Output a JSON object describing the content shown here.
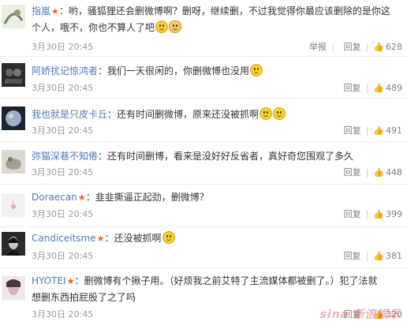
{
  "colors": {
    "username": "#4a7ab8",
    "star": "#e8641b",
    "meta": "#999999",
    "divider": "#eeeeee"
  },
  "comments": [
    {
      "user": "指嵐",
      "verified": true,
      "text_line1": "：哟，骚狐狸还会删微博啊？删呀，继续删，不过我觉得你最应该删除的是你这",
      "text_line2": "个人，哦不，你也不算人了吧",
      "emojis": [
        "surprised-emoji-icon",
        "cat-emoji-icon"
      ],
      "time": "3月30日 20:45",
      "report": "举报",
      "reply": "回复",
      "likes": "628"
    },
    {
      "user": "阿娇扰记惊鸿者",
      "verified": false,
      "text_line1": "：我们一天很闲的，你删微博也没用",
      "emojis": [
        "smile-emoji-icon"
      ],
      "time": "3月30日 20:45",
      "reply": "回复",
      "likes": "489"
    },
    {
      "user": "我也就是只皮卡丘",
      "verified": false,
      "text_line1": "：还有时间删微博，原来还没被抓啊",
      "emojis": [
        "smile-emoji-icon",
        "smile-emoji-icon"
      ],
      "time": "3月30日 20:45",
      "reply": "回复",
      "likes": "491"
    },
    {
      "user": "弥猫深巷不知倦",
      "verified": false,
      "text_line1": "：还有时间删博，看来是没好好反省者，真好奇您围观了多久",
      "emojis": [],
      "time": "3月30日 20:45",
      "reply": "回复",
      "likes": "448"
    },
    {
      "user": "Doraecan",
      "verified": true,
      "text_line1": "：韭韭撕逼正起劲，删微博？",
      "emojis": [],
      "time": "3月30日 20:45",
      "reply": "回复",
      "likes": "399"
    },
    {
      "user": "Candiceitsme",
      "verified": true,
      "text_line1": "：还没被抓啊",
      "emojis": [
        "smile-emoji-icon"
      ],
      "time": "3月30日 20:45",
      "reply": "回复",
      "likes": "381"
    },
    {
      "user": "HYOTEI",
      "verified": true,
      "text_line1": "：删微博有个揪子用。（好烦我之前艾特了主流媒体都被删了。）犯了法就",
      "text_line2": "想删东西拍屁股了之了吗",
      "emojis": [],
      "time": "3月30日 20:45",
      "reply": "回复",
      "likes": "320"
    }
  ],
  "watermark": "sina 新浪娱乐"
}
